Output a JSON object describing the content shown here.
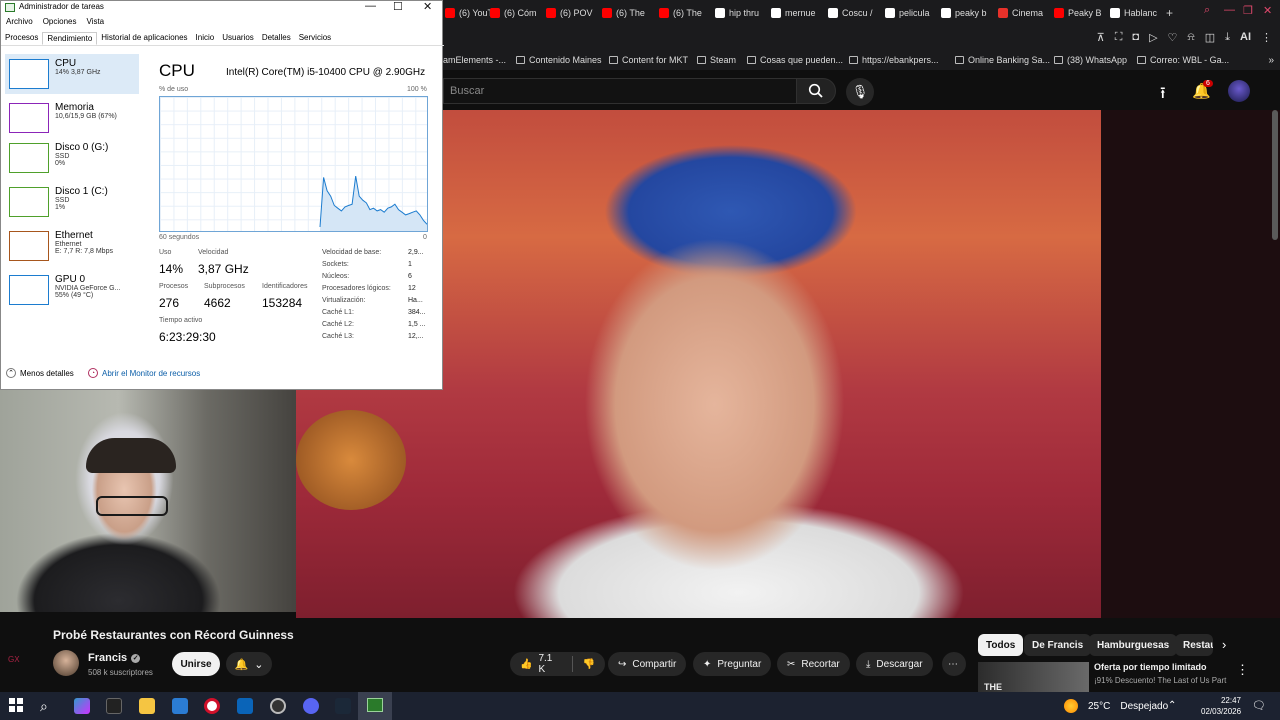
{
  "browser": {
    "tabs": [
      {
        "label": "(6) YouT",
        "color": "#ff0000"
      },
      {
        "label": "(6) Cóm",
        "color": "#ff0000"
      },
      {
        "label": "(6) POV",
        "color": "#ff0000"
      },
      {
        "label": "(6) The",
        "color": "#ff0000"
      },
      {
        "label": "(6) The",
        "color": "#ff0000"
      },
      {
        "label": "hip thru",
        "color": "#ffffff"
      },
      {
        "label": "mernue",
        "color": "#ffffff"
      },
      {
        "label": "Coscu /",
        "color": "#ffffff"
      },
      {
        "label": "pelicula",
        "color": "#ffffff"
      },
      {
        "label": "peaky b",
        "color": "#ffffff"
      },
      {
        "label": "Cinema",
        "color": "#e8312a"
      },
      {
        "label": "Peaky B",
        "color": "#ff0000"
      },
      {
        "label": "Hablanc",
        "color": "#ffffff"
      }
    ],
    "new_tab": "+",
    "bookmarks": [
      {
        "label": "amElements -..."
      },
      {
        "label": "Contenido Maines"
      },
      {
        "label": "Content for MKT"
      },
      {
        "label": "Steam"
      },
      {
        "label": "Cosas que pueden..."
      },
      {
        "label": "https://ebankpers..."
      },
      {
        "label": "Online Banking Sa..."
      },
      {
        "label": "(38) WhatsApp"
      },
      {
        "label": "Correo: WBL - Ga..."
      }
    ],
    "toolbar_ai": "AI"
  },
  "youtube": {
    "search_placeholder": "Buscar",
    "notification_count": "6",
    "video_title": "Probé Restaurantes con Récord Guinness",
    "channel_name": "Francis",
    "subscribers": "508 k suscriptores",
    "join_label": "Unirse",
    "likes": "7.1 K",
    "share_label": "Compartir",
    "ask_label": "Preguntar",
    "clip_label": "Recortar",
    "download_label": "Descargar",
    "chips": [
      "Todos",
      "De Francis",
      "Hamburguesas",
      "Restau"
    ],
    "ad_title": "Oferta por tiempo limitado",
    "ad_desc": "¡91% Descuento! The Last of Us Part",
    "ad_thumb_text": "THE",
    "left_strip": "GX"
  },
  "task_manager": {
    "title": "Administrador de tareas",
    "menu": [
      "Archivo",
      "Opciones",
      "Vista"
    ],
    "tabs": [
      "Procesos",
      "Rendimiento",
      "Historial de aplicaciones",
      "Inicio",
      "Usuarios",
      "Detalles",
      "Servicios"
    ],
    "active_tab": "Rendimiento",
    "resources": [
      {
        "name": "CPU",
        "sub1": "14%  3,87 GHz",
        "sub2": "",
        "sub3": "",
        "color": "#1c7ccf"
      },
      {
        "name": "Memoria",
        "sub1": "10,6/15,9 GB (67%)",
        "sub2": "",
        "sub3": "",
        "color": "#8b25b8"
      },
      {
        "name": "Disco 0 (G:)",
        "sub1": "SSD",
        "sub2": "0%",
        "sub3": "",
        "color": "#4fa02b"
      },
      {
        "name": "Disco 1 (C:)",
        "sub1": "SSD",
        "sub2": "1%",
        "sub3": "",
        "color": "#4fa02b"
      },
      {
        "name": "Ethernet",
        "sub1": "Ethernet",
        "sub2": "E: 7,7  R: 7,8 Mbps",
        "sub3": "",
        "color": "#a7561d"
      },
      {
        "name": "GPU 0",
        "sub1": "NVIDIA GeForce G...",
        "sub2": "55% (49 °C)",
        "sub3": "",
        "color": "#1c7ccf"
      }
    ],
    "cpu_heading": "CPU",
    "cpu_model": "Intel(R) Core(TM) i5-10400 CPU @ 2.90GHz",
    "graph_top_left": "% de uso",
    "graph_top_right": "100 %",
    "graph_bottom_left": "60 segundos",
    "graph_bottom_right": "0",
    "stats": {
      "uso_label": "Uso",
      "uso_value": "14%",
      "vel_label": "Velocidad",
      "vel_value": "3,87 GHz",
      "proc_label": "Procesos",
      "proc_value": "276",
      "sub_label": "Subprocesos",
      "sub_value": "4662",
      "ids_label": "Identificadores",
      "ids_value": "153284",
      "time_label": "Tiempo activo",
      "time_value": "6:23:29:30"
    },
    "specs": [
      {
        "label": "Velocidad de base:",
        "value": "2,9..."
      },
      {
        "label": "Sockets:",
        "value": "1"
      },
      {
        "label": "Núcleos:",
        "value": "6"
      },
      {
        "label": "Procesadores lógicos:",
        "value": "12"
      },
      {
        "label": "Virtualización:",
        "value": "Ha..."
      },
      {
        "label": "Caché L1:",
        "value": "384..."
      },
      {
        "label": "Caché L2:",
        "value": "1,5 ..."
      },
      {
        "label": "Caché L3:",
        "value": "12,..."
      }
    ],
    "less_details": "Menos detalles",
    "resource_monitor": "Abrir el Monitor de recursos",
    "cpu_history": [
      2,
      2,
      2,
      2,
      2,
      2,
      2,
      2,
      2,
      2,
      2,
      2,
      2,
      2,
      2,
      2,
      2,
      2,
      2,
      2,
      2,
      2,
      2,
      2,
      2,
      2,
      2,
      2,
      2,
      2,
      2,
      2,
      2,
      2,
      2,
      2,
      2,
      2,
      2,
      2,
      2,
      2,
      2,
      2,
      2,
      2,
      2,
      2,
      2,
      2,
      2,
      2,
      2,
      2,
      2,
      2,
      2,
      2,
      2,
      2,
      2,
      2,
      2,
      2,
      2,
      2,
      2,
      2,
      2,
      2,
      2,
      2,
      2,
      2,
      2,
      2,
      2,
      2,
      2,
      2,
      2,
      2,
      2,
      2,
      2,
      2,
      2,
      2,
      2,
      2,
      2,
      2,
      2,
      2,
      2,
      2,
      2,
      2,
      2,
      2,
      2,
      2,
      2,
      2,
      2,
      2,
      2,
      2,
      2,
      2,
      2,
      2,
      2,
      2,
      2,
      2,
      2,
      2,
      2,
      2,
      2,
      2,
      2,
      2,
      2,
      2,
      2,
      2,
      2,
      2,
      2,
      2,
      2,
      2,
      2,
      2,
      2,
      2,
      2,
      2,
      2,
      2,
      2,
      2,
      2,
      2,
      2,
      2,
      2,
      2,
      2,
      2,
      2,
      2,
      2,
      2,
      2,
      2,
      2,
      2,
      2,
      2,
      2,
      2,
      2,
      2,
      2,
      2,
      2,
      2,
      2,
      2,
      2,
      2,
      2,
      2,
      2,
      2,
      2,
      2,
      2,
      2,
      2,
      2,
      2,
      2,
      2,
      2,
      2,
      2,
      2,
      2,
      2,
      2,
      2,
      2,
      2,
      2,
      2,
      2,
      2,
      2,
      2,
      2,
      2,
      2,
      2,
      2,
      2,
      2,
      2,
      2,
      2,
      2,
      2,
      2,
      2,
      2,
      2,
      2,
      2,
      2,
      2,
      2,
      2,
      2,
      2,
      2,
      2,
      2,
      2,
      2,
      2,
      2,
      2,
      2,
      2,
      2,
      2,
      2,
      2,
      2,
      2,
      2,
      2,
      2,
      2,
      2,
      2,
      2,
      2,
      2,
      2,
      2,
      2,
      2,
      2,
      2,
      2,
      2
    ]
  },
  "taskbar": {
    "weather_temp": "25°C",
    "weather_desc": "Despejado",
    "time": "22:47",
    "date": "02/03/2026"
  }
}
